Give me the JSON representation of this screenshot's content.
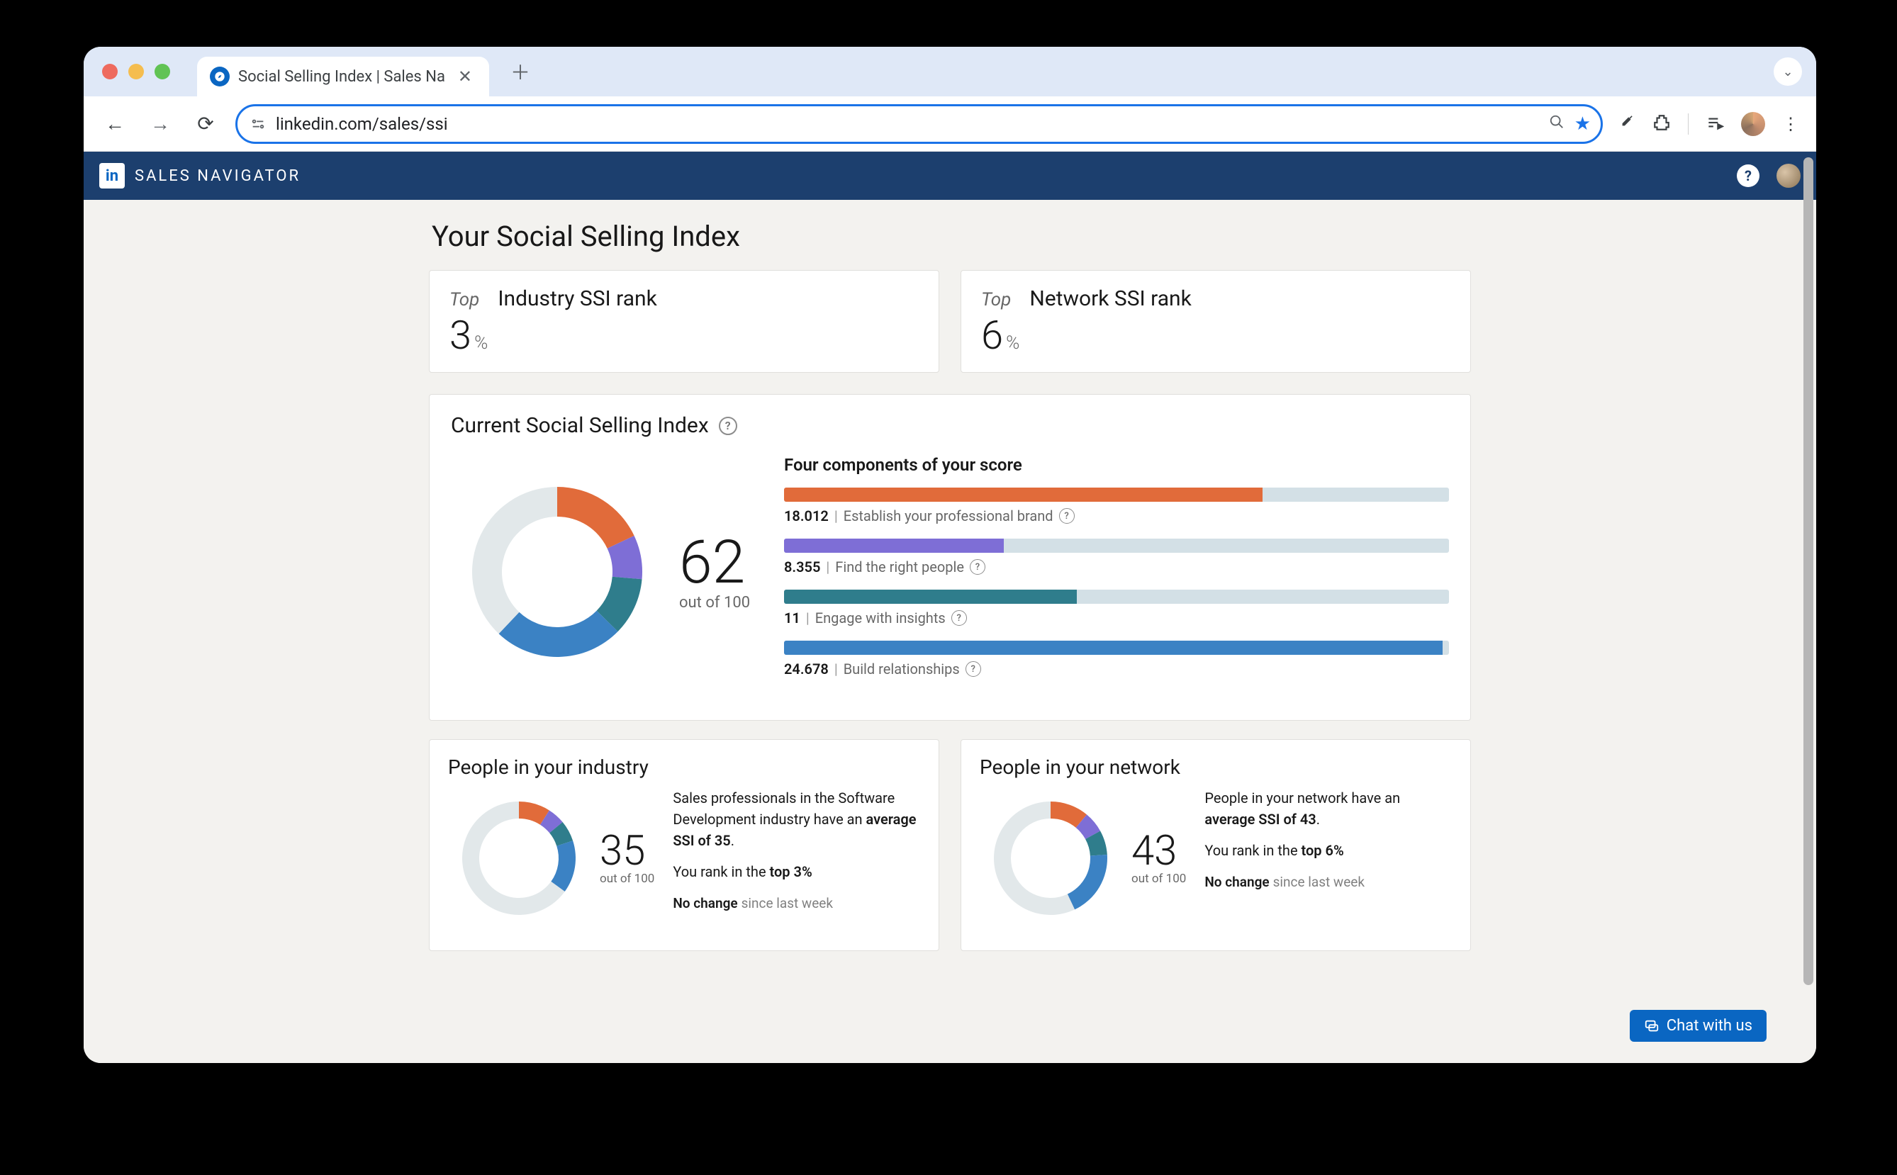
{
  "browser": {
    "tab_title": "Social Selling Index | Sales Na",
    "url": "linkedin.com/sales/ssi"
  },
  "navbar": {
    "brand": "SALES NAVIGATOR"
  },
  "page_title": "Your Social Selling Index",
  "ranks": {
    "industry": {
      "top": "Top",
      "label": "Industry SSI rank",
      "value": "3",
      "suffix": "%"
    },
    "network": {
      "top": "Top",
      "label": "Network SSI rank",
      "value": "6",
      "suffix": "%"
    }
  },
  "ssi": {
    "heading": "Current Social Selling Index",
    "score": "62",
    "out_of": "out of 100",
    "components_heading": "Four components of your score",
    "components": [
      {
        "value": "18.012",
        "label": "Establish your professional brand",
        "pct": 72,
        "color": "c-orange"
      },
      {
        "value": "8.355",
        "label": "Find the right people",
        "pct": 33,
        "color": "c-purple"
      },
      {
        "value": "11",
        "label": "Engage with insights",
        "pct": 44,
        "color": "c-teal"
      },
      {
        "value": "24.678",
        "label": "Build relationships",
        "pct": 99,
        "color": "c-blue"
      }
    ]
  },
  "industry_card": {
    "heading": "People in your industry",
    "score": "35",
    "out_of": "out of 100",
    "text_pre": "Sales professionals in the Software Development industry have an ",
    "text_bold": "average SSI of 35",
    "rank_pre": "You rank in the ",
    "rank_bold": "top 3%",
    "no_change": "No change",
    "since": "since last week"
  },
  "network_card": {
    "heading": "People in your network",
    "score": "43",
    "out_of": "out of 100",
    "text_pre": "People in your network have an ",
    "text_bold": "average SSI of 43",
    "rank_pre": "You rank in the ",
    "rank_bold": "top 6%",
    "no_change": "No change",
    "since": "since last week"
  },
  "chat_label": "Chat with us",
  "chart_data": [
    {
      "type": "pie",
      "title": "Current Social Selling Index",
      "total": 100,
      "score": 62,
      "series": [
        {
          "name": "Establish your professional brand",
          "value": 18.012,
          "color": "#e16b3a"
        },
        {
          "name": "Find the right people",
          "value": 8.355,
          "color": "#7e6ed6"
        },
        {
          "name": "Engage with insights",
          "value": 11,
          "color": "#2f7d8c"
        },
        {
          "name": "Build relationships",
          "value": 24.678,
          "color": "#3b82c4"
        },
        {
          "name": "Remaining",
          "value": 37.955,
          "color": "#e2e8ea"
        }
      ]
    },
    {
      "type": "bar",
      "title": "Four components of your score",
      "xlabel": "",
      "ylabel": "",
      "ylim": [
        0,
        25
      ],
      "categories": [
        "Establish your professional brand",
        "Find the right people",
        "Engage with insights",
        "Build relationships"
      ],
      "values": [
        18.012,
        8.355,
        11,
        24.678
      ]
    },
    {
      "type": "pie",
      "title": "People in your industry",
      "total": 100,
      "score": 35,
      "series": [
        {
          "name": "Establish your professional brand",
          "value": 9,
          "color": "#e16b3a"
        },
        {
          "name": "Find the right people",
          "value": 5,
          "color": "#7e6ed6"
        },
        {
          "name": "Engage with insights",
          "value": 6,
          "color": "#2f7d8c"
        },
        {
          "name": "Build relationships",
          "value": 15,
          "color": "#3b82c4"
        },
        {
          "name": "Remaining",
          "value": 65,
          "color": "#e2e8ea"
        }
      ]
    },
    {
      "type": "pie",
      "title": "People in your network",
      "total": 100,
      "score": 43,
      "series": [
        {
          "name": "Establish your professional brand",
          "value": 11,
          "color": "#e16b3a"
        },
        {
          "name": "Find the right people",
          "value": 6,
          "color": "#7e6ed6"
        },
        {
          "name": "Engage with insights",
          "value": 7,
          "color": "#2f7d8c"
        },
        {
          "name": "Build relationships",
          "value": 19,
          "color": "#3b82c4"
        },
        {
          "name": "Remaining",
          "value": 57,
          "color": "#e2e8ea"
        }
      ]
    }
  ]
}
